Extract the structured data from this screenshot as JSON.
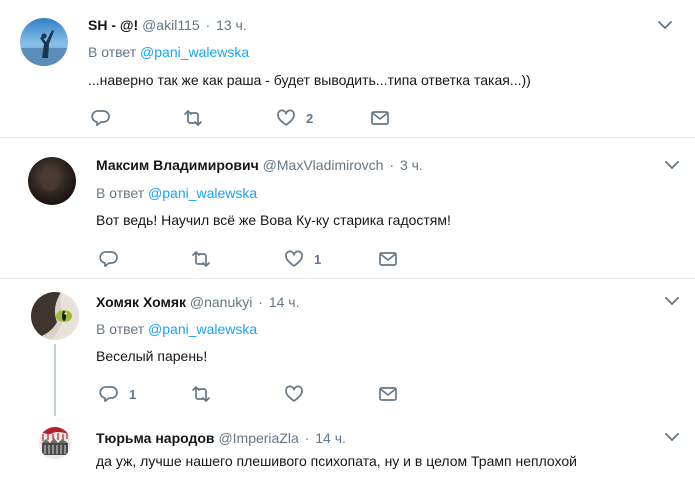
{
  "tweets": [
    {
      "name": "SH - @!",
      "handle": "@akil115",
      "dot": "·",
      "time": "13 ч.",
      "reply_prefix": "В ответ",
      "reply_to": "@pani_walewska",
      "text": "...наверно так же как раша - будет выводить...типа ответка такая...))",
      "replies": "",
      "retweets": "",
      "likes": "2"
    },
    {
      "name": "Максим Владимирович",
      "handle": "@MaxVladimirovch",
      "dot": "·",
      "time": "3 ч.",
      "reply_prefix": "В ответ",
      "reply_to": "@pani_walewska",
      "text": "Вот ведь! Научил всё же Вова Ку-ку старика гадостям!",
      "replies": "",
      "retweets": "",
      "likes": "1"
    },
    {
      "name": "Хомяк Хомяк",
      "handle": "@nanukyi",
      "dot": "·",
      "time": "14 ч.",
      "reply_prefix": "В ответ",
      "reply_to": "@pani_walewska",
      "text": "Веселый парень!",
      "replies": "1",
      "retweets": "",
      "likes": ""
    },
    {
      "name": "Тюрьма народов",
      "handle": "@ImperiaZla",
      "dot": "·",
      "time": "14 ч.",
      "text": "да уж, лучше нашего плешивого психопата, ну и в целом Трамп неплохой"
    }
  ],
  "icons": {
    "reply": "reply-icon",
    "retweet": "retweet-icon",
    "like": "heart-icon",
    "dm": "envelope-icon",
    "more": "chevron-down-icon"
  },
  "colors": {
    "link": "#1da1f2",
    "muted": "#657786",
    "text": "#14171a",
    "separator": "#e6ecf0"
  }
}
